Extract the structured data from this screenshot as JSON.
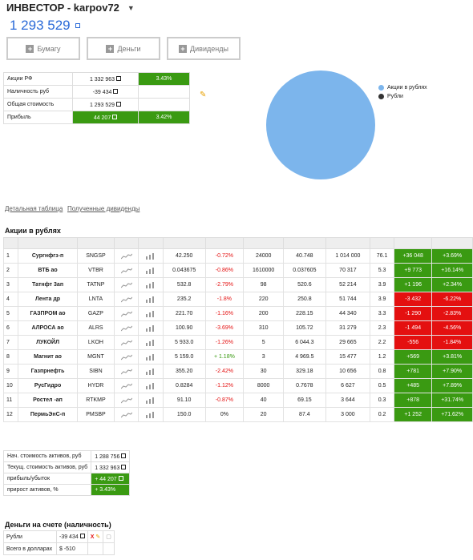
{
  "header": {
    "title": "ИНВЕСТОР - karpov72",
    "balance": "1 293 529"
  },
  "buttons": {
    "papers": "Бумагу",
    "money": "Деньги",
    "dividends": "Дивиденды"
  },
  "summary": [
    {
      "label": "Акции РФ",
      "value": "1 332 963",
      "pct": "3.43%"
    },
    {
      "label": "Наличность руб",
      "value": "-39 434",
      "pct": ""
    },
    {
      "label": "Общая стоимость",
      "value": "1 293 529",
      "pct": ""
    },
    {
      "label": "Прибыль",
      "value": "44 207",
      "pct": "3.42%"
    }
  ],
  "chart_data": {
    "type": "pie",
    "categories": [
      "Акции в рублях",
      "Рубли"
    ],
    "values": [
      100,
      0
    ],
    "colors": [
      "#7cb5ec",
      "#333333"
    ],
    "legend_position": "right"
  },
  "links": {
    "detailed": "Детальная таблица",
    "dividends": "Полученные дивиденды"
  },
  "stocks_title": "Акции в рублях",
  "stocks": [
    {
      "n": "1",
      "name": "Сургнфгз-п",
      "ticker": "SNGSP",
      "price": "42.250",
      "change": "-0.72%",
      "qty": "24000",
      "avg": "40.748",
      "value": "1 014 000",
      "share": "76.1",
      "profit": "+36 048",
      "profit_pct": "+3.69%"
    },
    {
      "n": "2",
      "name": "ВТБ ао",
      "ticker": "VTBR",
      "price": "0.043675",
      "change": "-0.86%",
      "qty": "1610000",
      "avg": "0.037605",
      "value": "70 317",
      "share": "5.3",
      "profit": "+9 773",
      "profit_pct": "+16.14%"
    },
    {
      "n": "3",
      "name": "Татнфт 3ап",
      "ticker": "TATNP",
      "price": "532.8",
      "change": "-2.79%",
      "qty": "98",
      "avg": "520.6",
      "value": "52 214",
      "share": "3.9",
      "profit": "+1 196",
      "profit_pct": "+2.34%"
    },
    {
      "n": "4",
      "name": "Лента др",
      "ticker": "LNTA",
      "price": "235.2",
      "change": "-1.8%",
      "qty": "220",
      "avg": "250.8",
      "value": "51 744",
      "share": "3.9",
      "profit": "-3 432",
      "profit_pct": "-6.22%"
    },
    {
      "n": "5",
      "name": "ГАЗПРОМ ао",
      "ticker": "GAZP",
      "price": "221.70",
      "change": "-1.16%",
      "qty": "200",
      "avg": "228.15",
      "value": "44 340",
      "share": "3.3",
      "profit": "-1 290",
      "profit_pct": "-2.83%"
    },
    {
      "n": "6",
      "name": "АЛРОСА ао",
      "ticker": "ALRS",
      "price": "100.90",
      "change": "-3.69%",
      "qty": "310",
      "avg": "105.72",
      "value": "31 279",
      "share": "2.3",
      "profit": "-1 494",
      "profit_pct": "-4.56%"
    },
    {
      "n": "7",
      "name": "ЛУКОЙЛ",
      "ticker": "LKOH",
      "price": "5 933.0",
      "change": "-1.26%",
      "qty": "5",
      "avg": "6 044.3",
      "value": "29 665",
      "share": "2.2",
      "profit": "-556",
      "profit_pct": "-1.84%"
    },
    {
      "n": "8",
      "name": "Магнит ао",
      "ticker": "MGNT",
      "price": "5 159.0",
      "change": "+ 1.18%",
      "qty": "3",
      "avg": "4 969.5",
      "value": "15 477",
      "share": "1.2",
      "profit": "+569",
      "profit_pct": "+3.81%"
    },
    {
      "n": "9",
      "name": "Газпрнефть",
      "ticker": "SIBN",
      "price": "355.20",
      "change": "-2.42%",
      "qty": "30",
      "avg": "329.18",
      "value": "10 656",
      "share": "0.8",
      "profit": "+781",
      "profit_pct": "+7.90%"
    },
    {
      "n": "10",
      "name": "РусГидро",
      "ticker": "HYDR",
      "price": "0.8284",
      "change": "-1.12%",
      "qty": "8000",
      "avg": "0.7678",
      "value": "6 627",
      "share": "0.5",
      "profit": "+485",
      "profit_pct": "+7.89%"
    },
    {
      "n": "11",
      "name": "Ростел -ап",
      "ticker": "RTKMP",
      "price": "91.10",
      "change": "-0.87%",
      "qty": "40",
      "avg": "69.15",
      "value": "3 644",
      "share": "0.3",
      "profit": "+878",
      "profit_pct": "+31.74%"
    },
    {
      "n": "12",
      "name": "ПермьЭнС-п",
      "ticker": "PMSBP",
      "price": "150.0",
      "change": "0%",
      "qty": "20",
      "avg": "87.4",
      "value": "3 000",
      "share": "0.2",
      "profit": "+1 252",
      "profit_pct": "+71.62%"
    }
  ],
  "assets": [
    {
      "label": "Нач. стоимость активов, руб",
      "value": "1 288 756"
    },
    {
      "label": "Текущ. стоимость активов, руб",
      "value": "1 332 963"
    },
    {
      "label": "прибыль/убыток",
      "value": "+ 44 207"
    },
    {
      "label": "прирост активов, %",
      "value": "+ 3.43%"
    }
  ],
  "cash_title": "Деньги на счете (наличность)",
  "cash": [
    {
      "label": "Рубли",
      "value": "-39 434"
    },
    {
      "label": "Всего в долларах",
      "value": "$ -510"
    }
  ]
}
